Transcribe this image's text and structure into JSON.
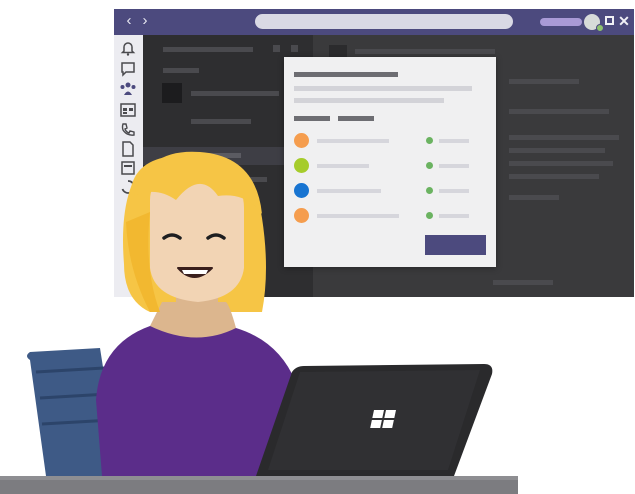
{
  "window": {
    "back_glyph": "‹",
    "forward_glyph": "›",
    "close_glyph": "✕",
    "search_placeholder": ""
  },
  "rail_icons": [
    "bell-icon",
    "chat-icon",
    "teams-icon",
    "calendar-icon",
    "phone-icon",
    "file-icon",
    "app-icon",
    "loading-icon"
  ],
  "dialog": {
    "people": [
      {
        "avatar_color": "#f59d4e",
        "status_color": "#6bb361"
      },
      {
        "avatar_color": "#a6cc2b",
        "status_color": "#6bb361"
      },
      {
        "avatar_color": "#1874d1",
        "status_color": "#6bb361"
      },
      {
        "avatar_color": "#f59d4e",
        "status_color": "#6bb361"
      }
    ],
    "button_label": ""
  },
  "colors": {
    "title_bar": "#4c4a7e",
    "rail": "#ececf1",
    "dark_pane": "#3a3a3c",
    "hair": "#f6c545",
    "sweater": "#5b2d8a",
    "laptop": "#2a2a2c"
  }
}
